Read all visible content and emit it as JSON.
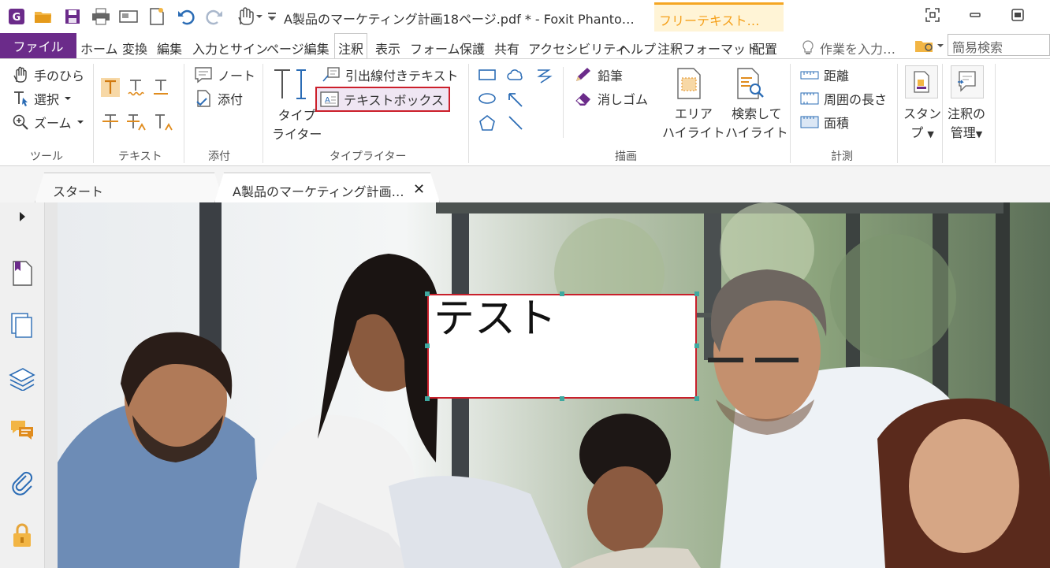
{
  "titlebar": {
    "doc_title": "A製品のマーケティング計画18ページ.pdf * - Foxit Phanto…",
    "context_tab": "フリーテキスト…",
    "quick_access": [
      "app-logo-icon",
      "open-folder-icon",
      "save-icon",
      "print-icon",
      "scan-icon",
      "new-doc-icon",
      "undo-icon",
      "redo-icon",
      "hand-dropdown-icon",
      "customize-icon"
    ]
  },
  "tabs": {
    "file": "ファイル",
    "items": [
      "ホーム",
      "変換",
      "編集",
      "入力とサイン",
      "ページ編集",
      "注釈",
      "表示",
      "フォーム",
      "保護",
      "共有",
      "アクセシビリティ",
      "ヘルプ",
      "注釈フォーマット",
      "配置"
    ],
    "active": "注釈",
    "search_hint": "作業を入力…",
    "search_placeholder": "簡易検索"
  },
  "ribbon": {
    "tools": {
      "hand": "手のひら",
      "select": "選択",
      "zoom": "ズーム",
      "label": "ツール"
    },
    "text": {
      "label": "テキスト"
    },
    "attach": {
      "note": "ノート",
      "attach": "添付",
      "label": "添付"
    },
    "typewriter": {
      "typewriter_l1": "タイプ",
      "typewriter_l2": "ライター",
      "callout": "引出線付きテキスト",
      "textbox": "テキストボックス",
      "label": "タイプライター"
    },
    "draw": {
      "pencil": "鉛筆",
      "eraser": "消しゴム",
      "area_l1": "エリア",
      "area_l2": "ハイライト",
      "search_l1": "検索して",
      "search_l2": "ハイライト",
      "label": "描画"
    },
    "measure": {
      "distance": "距離",
      "perimeter": "周囲の長さ",
      "area": "面積",
      "label": "計測"
    },
    "stamp": {
      "l1": "スタン",
      "l2": "プ"
    },
    "manage": {
      "l1": "注釈の",
      "l2": "管理"
    }
  },
  "doc_tabs": {
    "start": "スタート",
    "doc": "A製品のマーケティング計画…"
  },
  "annotation": {
    "text": "テスト"
  },
  "colors": {
    "accent": "#6b2b8a",
    "highlight_border": "#cc1f2b",
    "context_tab": "#f5a01a",
    "icon_orange": "#e08c1e",
    "icon_blue": "#2b6cb5"
  }
}
